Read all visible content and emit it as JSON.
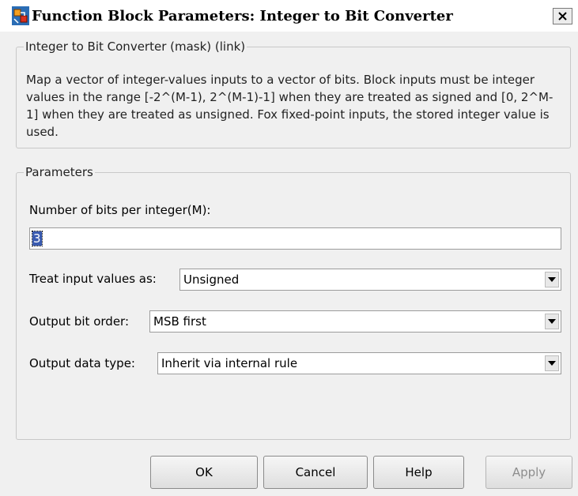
{
  "window": {
    "title": "Function Block Parameters: Integer to Bit Converter",
    "icon": "simulink-block-icon",
    "close_icon": "close-icon"
  },
  "description": {
    "legend": "Integer to Bit Converter (mask) (link)",
    "text": "Map a vector of integer-values inputs to a vector of bits.  Block inputs must be integer values in the range [-2^(M-1), 2^(M-1)-1]  when they are treated as signed and [0, 2^M-1] when they are treated as unsigned.  Fox fixed-point inputs, the stored integer value is used."
  },
  "parameters": {
    "legend": "Parameters",
    "bits_label": "Number of bits per integer(M):",
    "bits_value": "3",
    "treat_label": "Treat input values as:",
    "treat_value": "Unsigned",
    "order_label": "Output bit order:",
    "order_value": "MSB first",
    "dtype_label": "Output data type:",
    "dtype_value": "Inherit via internal rule"
  },
  "buttons": {
    "ok": "OK",
    "cancel": "Cancel",
    "help": "Help",
    "apply": "Apply"
  },
  "colors": {
    "selection": "#3a5bb0",
    "background": "#f0f0f0"
  }
}
